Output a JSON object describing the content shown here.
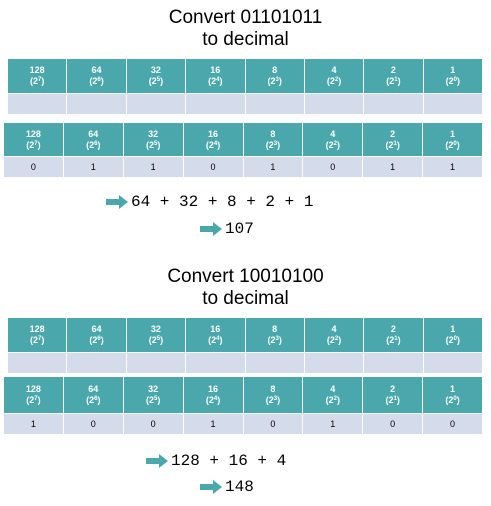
{
  "sections": [
    {
      "title_line1": "Convert 01101011",
      "title_line2": "to decimal",
      "headers": [
        {
          "value": "128",
          "base": "(2",
          "exp": "7",
          "close": ")"
        },
        {
          "value": "64",
          "base": "(2",
          "exp": "6",
          "close": ")"
        },
        {
          "value": "32",
          "base": "(2",
          "exp": "5",
          "close": ")"
        },
        {
          "value": "16",
          "base": "(2",
          "exp": "4",
          "close": ")"
        },
        {
          "value": "8",
          "base": "(2",
          "exp": "3",
          "close": ")"
        },
        {
          "value": "4",
          "base": "(2",
          "exp": "2",
          "close": ")"
        },
        {
          "value": "2",
          "base": "(2",
          "exp": "1",
          "close": ")"
        },
        {
          "value": "1",
          "base": "(2",
          "exp": "0",
          "close": ")"
        }
      ],
      "bits": [
        "0",
        "1",
        "1",
        "0",
        "1",
        "0",
        "1",
        "1"
      ],
      "sum": "64 + 32 + 8 + 2 + 1",
      "result": "107"
    },
    {
      "title_line1": "Convert 10010100",
      "title_line2": "to decimal",
      "headers": [
        {
          "value": "128",
          "base": "(2",
          "exp": "7",
          "close": ")"
        },
        {
          "value": "64",
          "base": "(2",
          "exp": "6",
          "close": ")"
        },
        {
          "value": "32",
          "base": "(2",
          "exp": "5",
          "close": ")"
        },
        {
          "value": "16",
          "base": "(2",
          "exp": "4",
          "close": ")"
        },
        {
          "value": "8",
          "base": "(2",
          "exp": "3",
          "close": ")"
        },
        {
          "value": "4",
          "base": "(2",
          "exp": "2",
          "close": ")"
        },
        {
          "value": "2",
          "base": "(2",
          "exp": "1",
          "close": ")"
        },
        {
          "value": "1",
          "base": "(2",
          "exp": "0",
          "close": ")"
        }
      ],
      "bits": [
        "1",
        "0",
        "0",
        "1",
        "0",
        "1",
        "0",
        "0"
      ],
      "sum": "128 + 16 + 4",
      "result": "148"
    }
  ],
  "colors": {
    "header": "#4aa8ac",
    "cell": "#d4dcec",
    "arrow": "#4aa8ac"
  }
}
